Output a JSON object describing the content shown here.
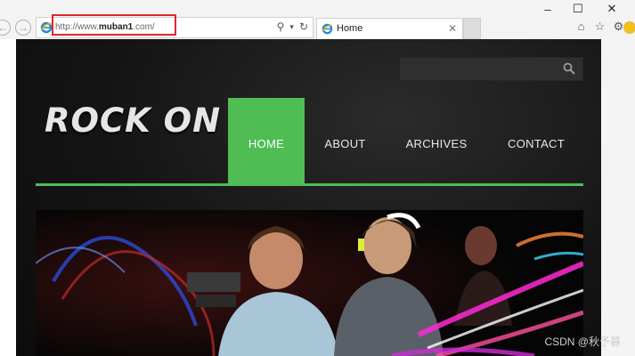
{
  "browser": {
    "address_url_prefix": "http://www.",
    "address_url_domain": "muban1",
    "address_url_suffix": ".com/",
    "tab_title": "Home",
    "window_controls": [
      "–",
      "☐",
      "✕"
    ],
    "highlight_color": "#e0262b"
  },
  "site": {
    "logo": "ROCK ON",
    "nav": [
      {
        "label": "HOME",
        "active": true
      },
      {
        "label": "ABOUT",
        "active": false
      },
      {
        "label": "ARCHIVES",
        "active": false
      },
      {
        "label": "CONTACT",
        "active": false
      }
    ],
    "accent_color": "#4fbd54"
  },
  "watermark": "CSDN @秋予暮"
}
